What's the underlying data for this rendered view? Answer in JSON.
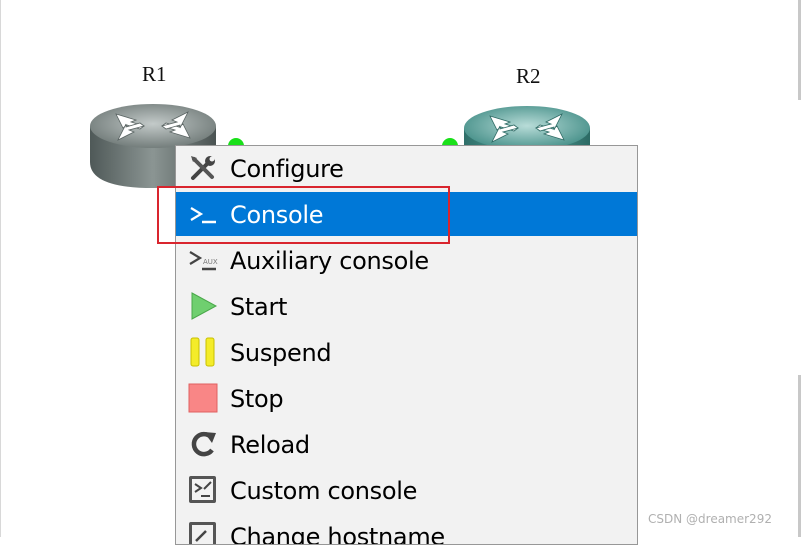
{
  "topology": {
    "nodes": [
      {
        "name": "R1",
        "icon": "router-icon"
      },
      {
        "name": "R2",
        "icon": "router-icon"
      }
    ]
  },
  "context_menu": {
    "items": [
      {
        "label": "Configure",
        "icon": "wrench-screwdriver-icon",
        "selected": false
      },
      {
        "label": "Console",
        "icon": "console-prompt-icon",
        "selected": true
      },
      {
        "label": "Auxiliary console",
        "icon": "auxiliary-console-icon",
        "selected": false
      },
      {
        "label": "Start",
        "icon": "play-icon",
        "selected": false
      },
      {
        "label": "Suspend",
        "icon": "pause-icon",
        "selected": false
      },
      {
        "label": "Stop",
        "icon": "stop-icon",
        "selected": false
      },
      {
        "label": "Reload",
        "icon": "reload-icon",
        "selected": false
      },
      {
        "label": "Custom console",
        "icon": "custom-console-icon",
        "selected": false
      },
      {
        "label": "Change hostname",
        "icon": "change-hostname-icon",
        "selected": false
      }
    ]
  },
  "colors": {
    "selection": "#0078d7",
    "highlight_box": "#d9252e",
    "status_green": "#19e019",
    "router_r1": "#6f7a78",
    "router_r2": "#3f8b84"
  },
  "watermark": "CSDN @dreamer292"
}
